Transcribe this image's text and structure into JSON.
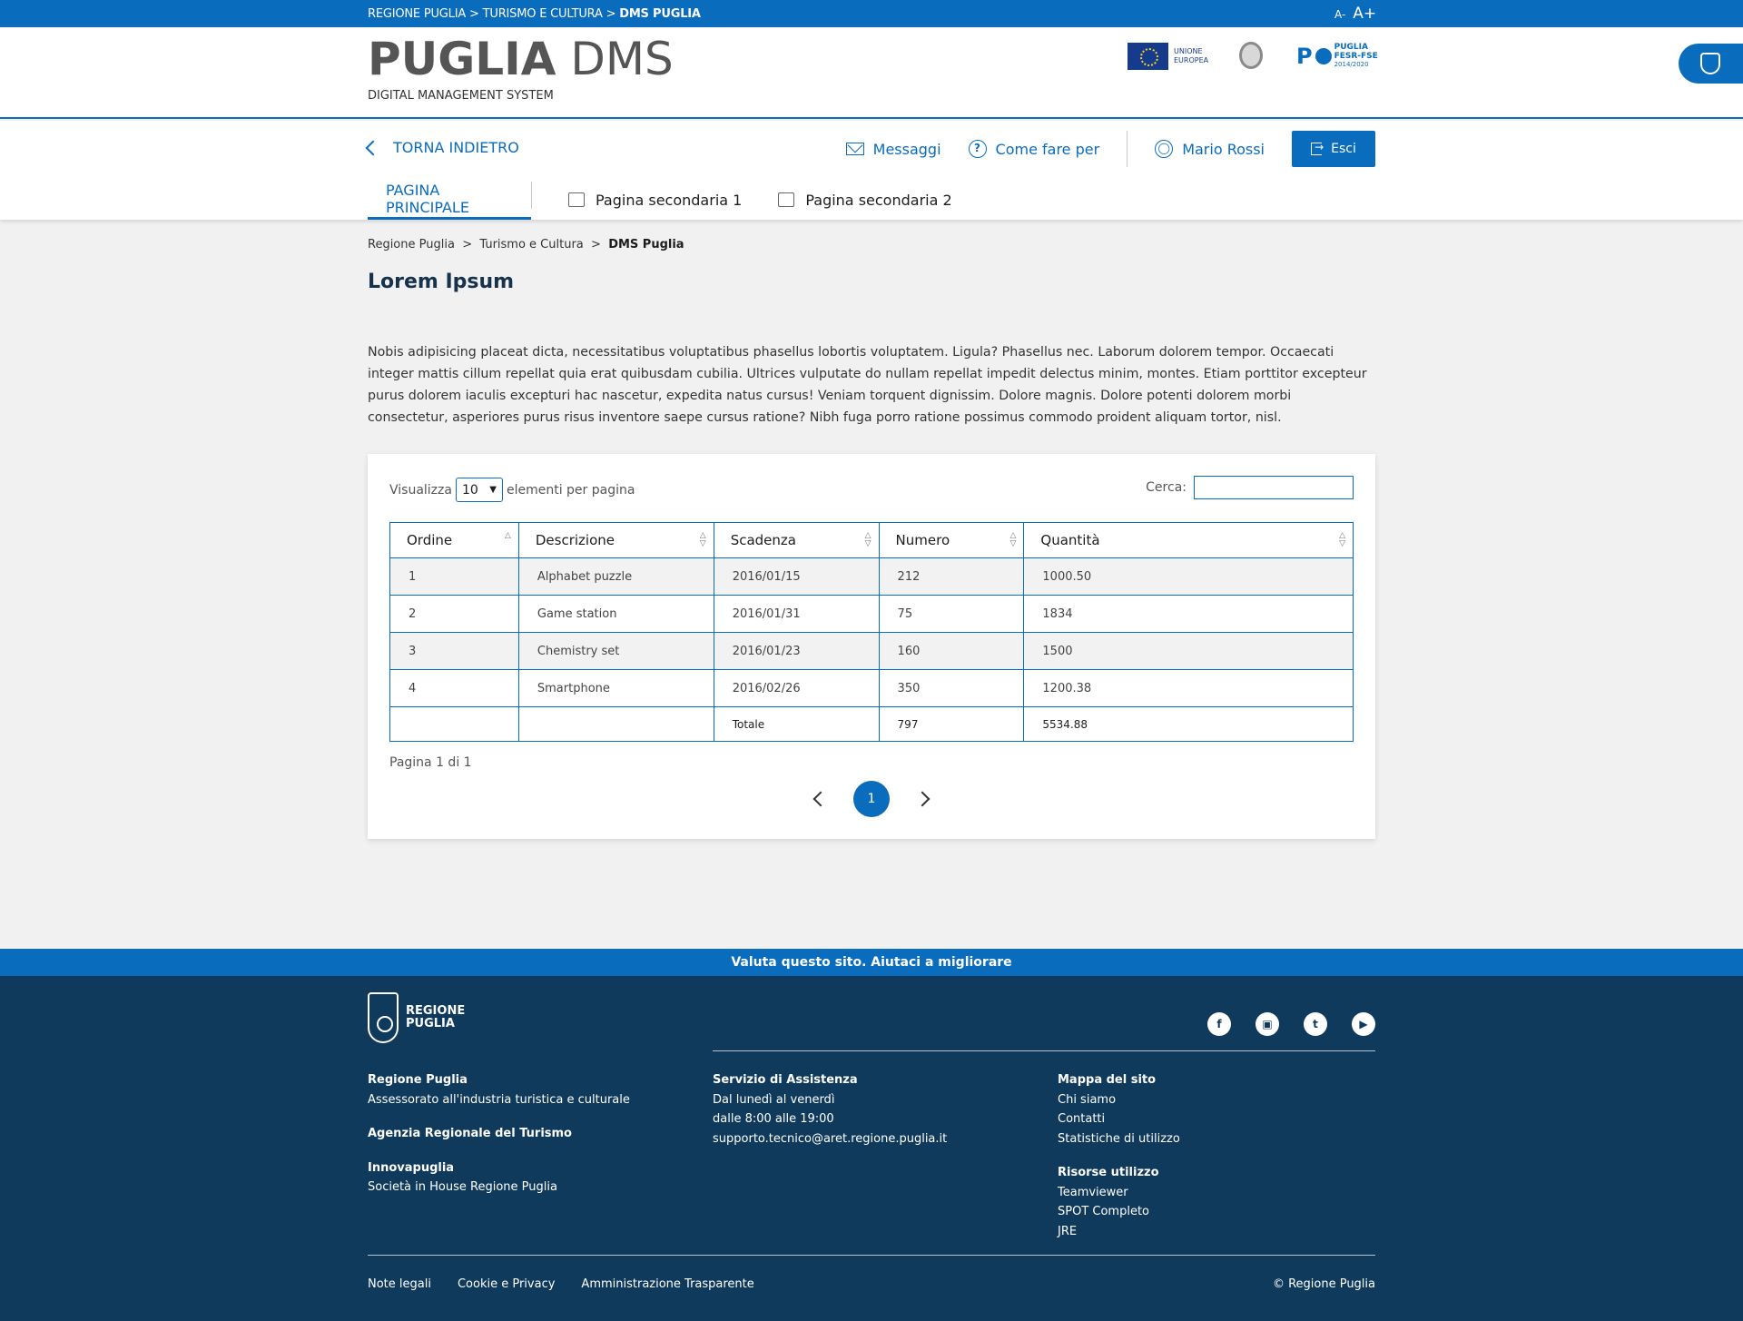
{
  "topbar": {
    "crumbs": [
      "REGIONE PUGLIA",
      "TURISMO E CULTURA",
      "DMS PUGLIA"
    ],
    "sep": ">",
    "font_small": "A-",
    "font_big": "A+"
  },
  "header": {
    "title_bold": "PUGLIA",
    "title_light": "DMS",
    "subtitle": "DIGITAL MANAGEMENT SYSTEM",
    "eu_line1": "UNIONE",
    "eu_line2": "EUROPEA",
    "por_line1": "PUGLIA",
    "por_line2": "FESR-FSE",
    "por_line3": "2014/2020"
  },
  "nav": {
    "back": "TORNA INDIETRO",
    "messages": "Messaggi",
    "howto": "Come fare per",
    "user": "Mario Rossi",
    "logout": "Esci",
    "tabs": [
      "PAGINA PRINCIPALE",
      "Pagina secondaria 1",
      "Pagina secondaria 2"
    ]
  },
  "breadcrumb": [
    "Regione Puglia",
    "Turismo e Cultura",
    "DMS Puglia"
  ],
  "page": {
    "title": "Lorem Ipsum",
    "intro": "Nobis adipisicing placeat dicta, necessitatibus voluptatibus phasellus lobortis voluptatem. Ligula? Phasellus nec. Laborum dolorem tempor. Occaecati integer mattis cillum repellat quia erat quibusdam cubilia. Ultrices vulputate do nullam repellat impedit delectus minim, montes. Etiam porttitor excepteur purus dolorem iaculis excepturi hac nascetur, expedita natus cursus! Veniam torquent dignissim. Dolore magnis. Dolore potenti dolorem morbi consectetur, asperiores purus risus inventore saepe cursus ratione? Nibh fuga porro ratione possimus commodo proident aliquam tortor, nisl."
  },
  "table": {
    "show_label": "Visualizza",
    "page_size": "10",
    "per_page_label": "elementi per pagina",
    "search_label": "Cerca:",
    "search_value": "",
    "headers": [
      "Ordine",
      "Descrizione",
      "Scadenza",
      "Numero",
      "Quantità"
    ],
    "rows": [
      [
        "1",
        "Alphabet puzzle",
        "2016/01/15",
        "212",
        "1000.50"
      ],
      [
        "2",
        "Game station",
        "2016/01/31",
        "75",
        "1834"
      ],
      [
        "3",
        "Chemistry set",
        "2016/01/23",
        "160",
        "1500"
      ],
      [
        "4",
        "Smartphone",
        "2016/02/26",
        "350",
        "1200.38"
      ]
    ],
    "total_label": "Totale",
    "total_numero": "797",
    "total_quantita": "5534.88",
    "page_info": "Pagina 1 di 1",
    "current_page": "1"
  },
  "footer": {
    "feedback": "Valuta questo sito. Aiutaci a migliorare",
    "logo_line1": "REGIONE",
    "logo_line2": "PUGLIA",
    "social": [
      "facebook-icon",
      "instagram-icon",
      "twitter-icon",
      "youtube-icon"
    ],
    "col1": {
      "h1": "Regione Puglia",
      "t1": "Assessorato all'industria turistica e culturale",
      "h2": "Agenzia Regionale del Turismo",
      "h3": "Innovapuglia",
      "t3": "Società in House Regione Puglia"
    },
    "col2": {
      "h1": "Servizio di Assistenza",
      "t1": "Dal lunedì al venerdì",
      "t2": "dalle 8:00 alle 19:00",
      "t3": "supporto.tecnico@aret.regione.puglia.it"
    },
    "col3": {
      "h1": "Mappa del sito",
      "links1": [
        "Chi siamo",
        "Contatti",
        "Statistiche di utilizzo"
      ],
      "h2": "Risorse utilizzo",
      "links2": [
        "Teamviewer",
        "SPOT Completo",
        "JRE"
      ]
    },
    "legal": [
      "Note legali",
      "Cookie e Privacy",
      "Amministrazione Trasparente"
    ],
    "copyright": "© Regione Puglia"
  },
  "colors": {
    "primary": "#0a6cbd",
    "footer": "#0f3a5c",
    "title": "#17324d"
  }
}
